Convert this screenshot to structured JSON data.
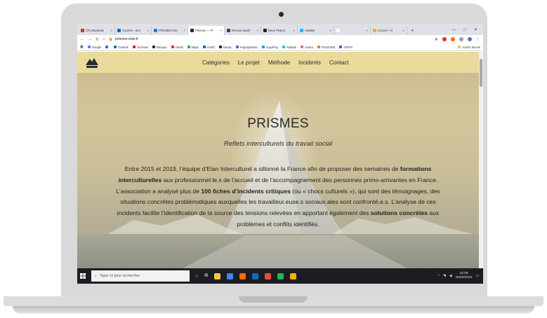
{
  "browser": {
    "tabs": [
      {
        "label": "CR préparatoi",
        "color": "#d93025",
        "active": false
      },
      {
        "label": "Courrier - ann",
        "color": "#0f6cbd",
        "active": false
      },
      {
        "label": "PRISMES Noc",
        "color": "#2b7bd6",
        "active": false
      },
      {
        "label": "Prismes — Fr",
        "color": "#2a2a2a",
        "active": true
      },
      {
        "label": "Remove Back",
        "color": "#444444",
        "active": false
      },
      {
        "label": "Nouv Project",
        "color": "#222222",
        "active": false
      },
      {
        "label": "Airtable",
        "color": "#18bfff",
        "active": false
      },
      {
        "label": "",
        "color": "#ffffff",
        "active": false
      },
      {
        "label": "Accueil - Ar",
        "color": "#f4b400",
        "active": false
      }
    ],
    "new_tab": "+",
    "window_controls": [
      "—",
      "□",
      "✕"
    ],
    "url": "prismes-elan.fr",
    "bookmarks": [
      {
        "label": "Google",
        "color": "#4285f4"
      },
      {
        "label": "",
        "color": "#1a73e8"
      },
      {
        "label": "Outlook",
        "color": "#0f6cbd"
      },
      {
        "label": "YouTube",
        "color": "#ff0000"
      },
      {
        "label": "Banque",
        "color": "#2a2a2a"
      },
      {
        "label": "Gmail",
        "color": "#d93025"
      },
      {
        "label": "Maps",
        "color": "#34a853"
      },
      {
        "label": "SUEZ",
        "color": "#0066b3"
      },
      {
        "label": "DeepL",
        "color": "#0f2b46"
      },
      {
        "label": "Kilgrapheuse",
        "color": "#8e44ad"
      },
      {
        "label": "AquaPay",
        "color": "#00a0e0"
      },
      {
        "label": "Airtable",
        "color": "#18bfff"
      },
      {
        "label": "Asana",
        "color": "#f06a6a"
      },
      {
        "label": "POLESEE",
        "color": "#e67e22"
      },
      {
        "label": "GIPHY",
        "color": "#6e3cff"
      }
    ],
    "bookmarks_more": "Autres favoris"
  },
  "site": {
    "nav": [
      "Catégories",
      "Le projet",
      "Méthode",
      "Incidents",
      "Contact"
    ],
    "title": "PRISMES",
    "subtitle": "Reflets interculturels du travail social",
    "body": {
      "p1": "Entre 2015 et 2019, l’équipe d’Elan Interculturel a sillonné la France afin de proposer des semaines de ",
      "b1": "formations interculturelles",
      "p2": " aux professionnel.le.s de l’accueil et de l’accompagnement des personnes primo-arrivantes en France. L’association a analysé plus de ",
      "b2": "100 fiches d’incidents critiques",
      "p3": " (ou « chocs culturels »), qui sont des témoignages, des situations concrètes problématiques auxquelles les travailleur.euse.s sociaux.ales sont confronté.e.s. L’analyse de ces incidents facilite l’identification de la source des tensions relevées en apportant également des ",
      "b3": "solutions concrètes",
      "p4": " aux problèmes et conflits identifiés."
    }
  },
  "taskbar": {
    "search_placeholder": "Taper ici pour rechercher",
    "time": "15:08",
    "date": "25/06/2020",
    "icon_colors": [
      "#f5c542",
      "#4285f4",
      "#ff6d00",
      "#0f6cbd",
      "#e74c3c",
      "#1db954",
      "#f0b400"
    ]
  }
}
